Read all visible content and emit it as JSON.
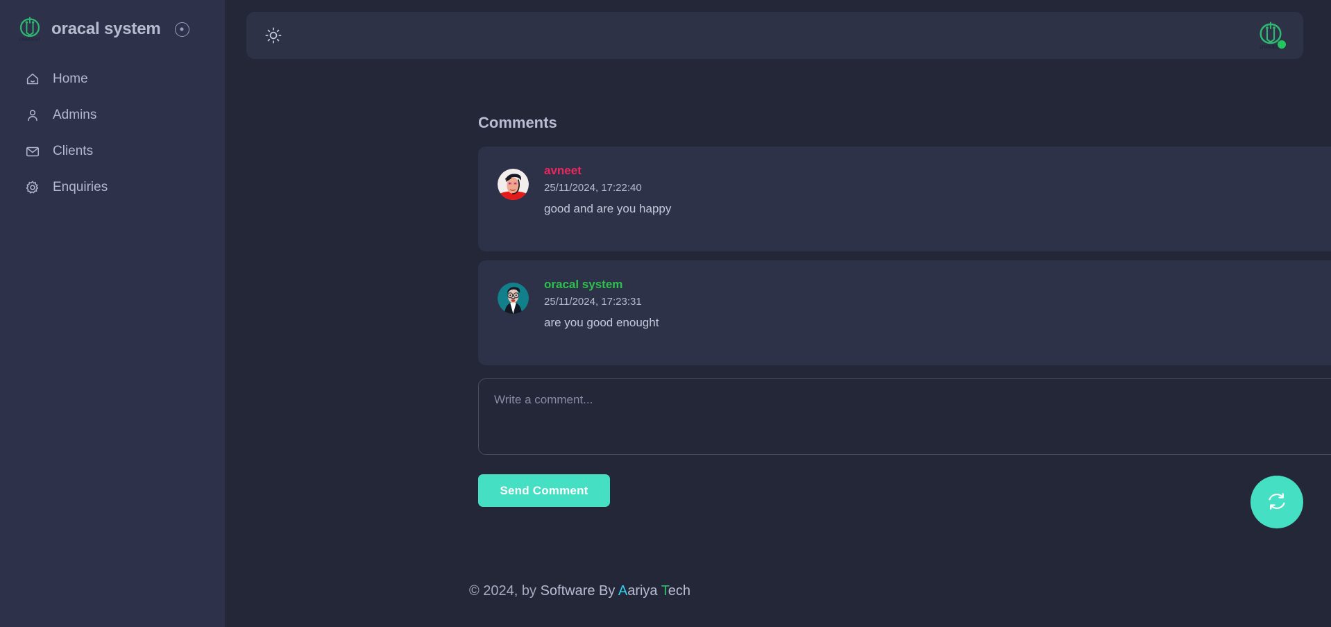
{
  "brand": {
    "title": "oracal system",
    "logo_text": "LINGUEST",
    "logo_color": "#2eb872",
    "toggle_name": "collapse-sidebar-toggle"
  },
  "sidebar": {
    "items": [
      {
        "label": "Home",
        "icon": "home-icon"
      },
      {
        "label": "Admins",
        "icon": "user-icon"
      },
      {
        "label": "Clients",
        "icon": "envelope-icon"
      },
      {
        "label": "Enquiries",
        "icon": "gear-icon"
      }
    ]
  },
  "topbar": {
    "theme_toggle_icon": "sun-icon",
    "avatar_icon": "linguest-logo-avatar",
    "status": "online",
    "status_color": "#22c55e"
  },
  "main": {
    "section_title": "Comments",
    "comments": [
      {
        "author": "avneet",
        "author_color": "#e8285f",
        "date": "25/11/2024, 17:22:40",
        "text": "good and are you happy",
        "avatar": "avatar-avneet"
      },
      {
        "author": "oracal system",
        "author_color": "#2fbf4e",
        "date": "25/11/2024, 17:23:31",
        "text": "are you good enought",
        "avatar": "avatar-oracal-system"
      }
    ],
    "composer": {
      "placeholder": "Write a comment...",
      "value": "",
      "send_label": "Send Comment",
      "send_color": "#45dfc4"
    },
    "refresh_button": {
      "icon": "refresh-icon",
      "color": "#45dfc4"
    }
  },
  "footer": {
    "copyright": "© 2024, by ",
    "software_by": "Software By ",
    "brand_a": "A",
    "brand_ariya": "ariya ",
    "brand_t": "T",
    "brand_ech": "ech"
  }
}
